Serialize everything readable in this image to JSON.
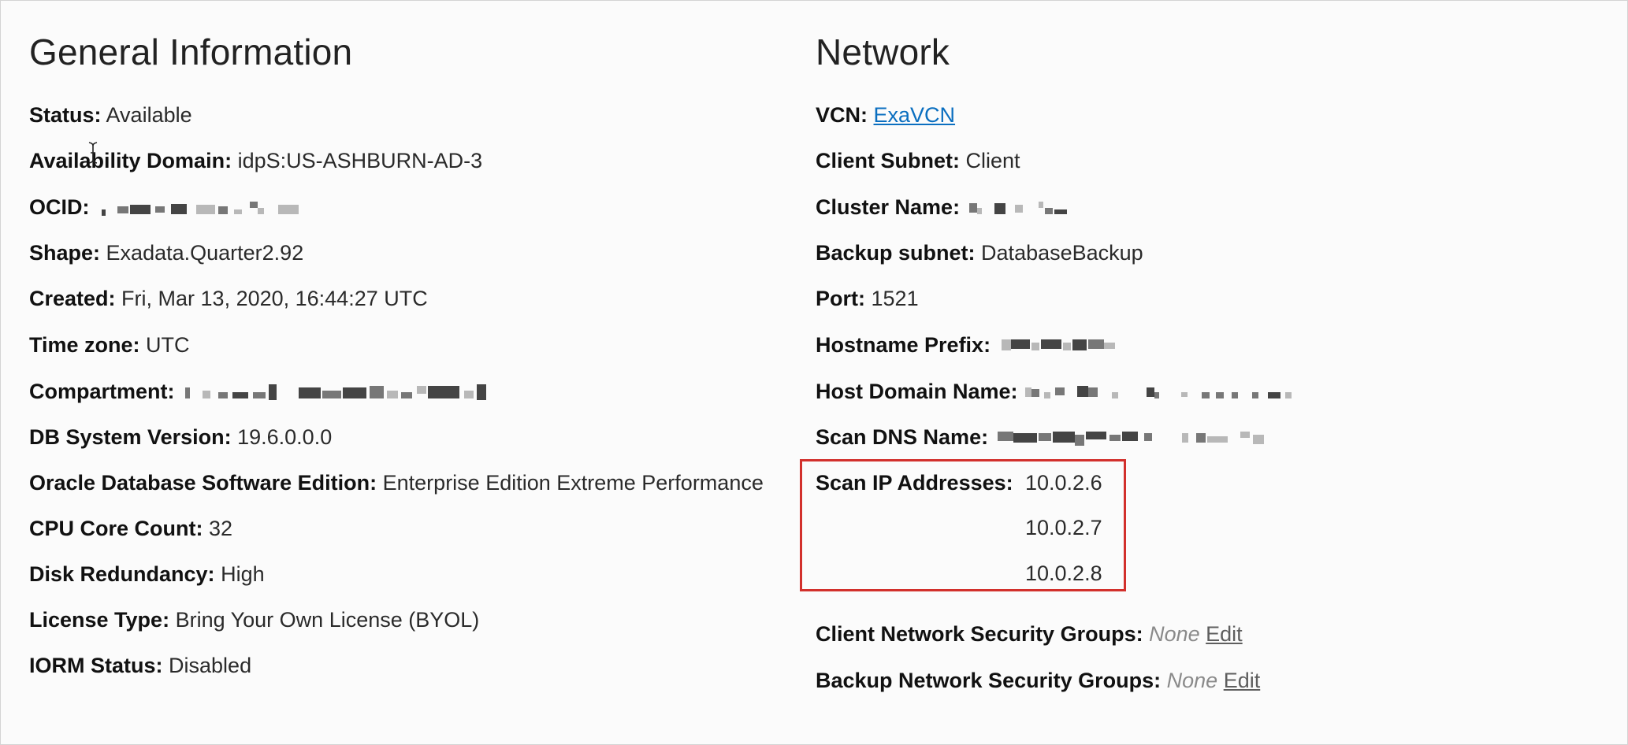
{
  "general": {
    "title": "General Information",
    "status": {
      "label": "Status:",
      "value": "Available"
    },
    "availability_domain": {
      "label": "Availability Domain:",
      "value": "idpS:US-ASHBURN-AD-3"
    },
    "ocid": {
      "label": "OCID:"
    },
    "shape": {
      "label": "Shape:",
      "value": "Exadata.Quarter2.92"
    },
    "created": {
      "label": "Created:",
      "value": "Fri, Mar 13, 2020, 16:44:27 UTC"
    },
    "time_zone": {
      "label": "Time zone:",
      "value": "UTC"
    },
    "compartment": {
      "label": "Compartment:"
    },
    "db_system_version": {
      "label": "DB System Version:",
      "value": "19.6.0.0.0"
    },
    "software_edition": {
      "label": "Oracle Database Software Edition:",
      "value": "Enterprise Edition Extreme Performance"
    },
    "cpu_core_count": {
      "label": "CPU Core Count:",
      "value": "32"
    },
    "disk_redundancy": {
      "label": "Disk Redundancy:",
      "value": "High"
    },
    "license_type": {
      "label": "License Type:",
      "value": "Bring Your Own License (BYOL)"
    },
    "iorm_status": {
      "label": "IORM Status:",
      "value": "Disabled"
    }
  },
  "network": {
    "title": "Network",
    "vcn": {
      "label": "VCN:",
      "value": "ExaVCN"
    },
    "client_subnet": {
      "label": "Client Subnet:",
      "value": "Client"
    },
    "cluster_name": {
      "label": "Cluster Name:"
    },
    "backup_subnet": {
      "label": "Backup subnet:",
      "value": "DatabaseBackup"
    },
    "port": {
      "label": "Port:",
      "value": "1521"
    },
    "hostname_prefix": {
      "label": "Hostname Prefix:"
    },
    "host_domain_name": {
      "label": "Host Domain Name:"
    },
    "scan_dns_name": {
      "label": "Scan DNS Name:"
    },
    "scan_ip": {
      "label": "Scan IP Addresses:",
      "values": [
        "10.0.2.6",
        "10.0.2.7",
        "10.0.2.8"
      ]
    },
    "client_nsg": {
      "label": "Client Network Security Groups:",
      "value": "None",
      "action": "Edit"
    },
    "backup_nsg": {
      "label": "Backup Network Security Groups:",
      "value": "None",
      "action": "Edit"
    }
  },
  "colors": {
    "link": "#0b6fc0",
    "highlight_border": "#d2302c"
  },
  "icons": {
    "cursor": "text-cursor-icon"
  }
}
